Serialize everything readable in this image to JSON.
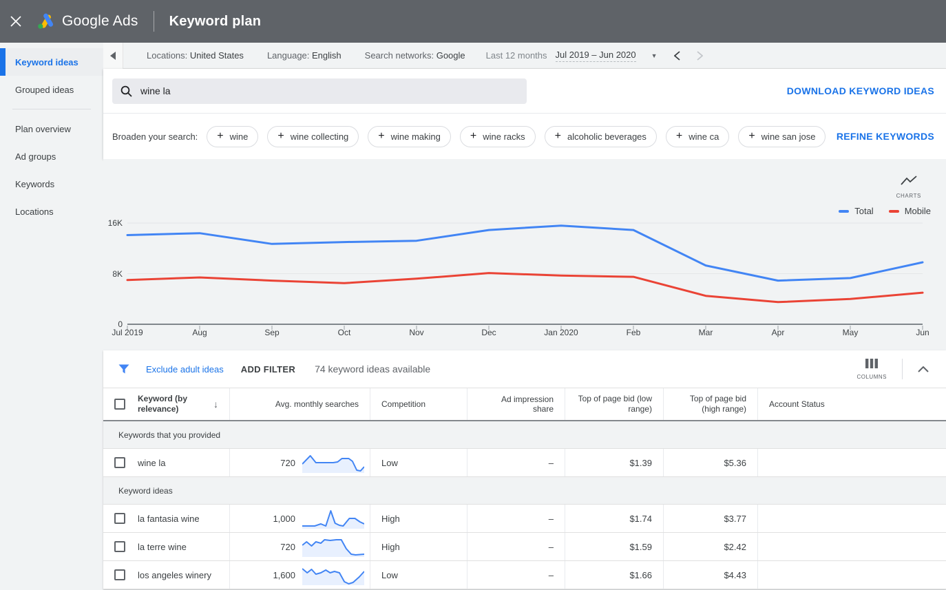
{
  "app_bar": {
    "brand": "Google Ads",
    "page_title": "Keyword plan"
  },
  "sidebar": {
    "items": [
      {
        "label": "Keyword ideas",
        "selected": true
      },
      {
        "label": "Grouped ideas",
        "selected": false
      },
      {
        "label": "Plan overview",
        "selected": false
      },
      {
        "label": "Ad groups",
        "selected": false
      },
      {
        "label": "Keywords",
        "selected": false
      },
      {
        "label": "Locations",
        "selected": false
      }
    ]
  },
  "settings_bar": {
    "locations_label": "Locations:",
    "locations_value": "United States",
    "language_label": "Language:",
    "language_value": "English",
    "networks_label": "Search networks:",
    "networks_value": "Google",
    "range_label": "Last 12 months",
    "range_value": "Jul 2019 – Jun 2020"
  },
  "search": {
    "query": "wine la",
    "download_link": "DOWNLOAD KEYWORD IDEAS"
  },
  "broaden": {
    "label": "Broaden your search:",
    "chips": [
      {
        "label": "wine"
      },
      {
        "label": "wine collecting"
      },
      {
        "label": "wine making"
      },
      {
        "label": "wine racks"
      },
      {
        "label": "alcoholic beverages"
      },
      {
        "label": "wine ca"
      },
      {
        "label": "wine san jose"
      }
    ],
    "refine_link": "REFINE KEYWORDS"
  },
  "chart_data": {
    "type": "line",
    "title": "",
    "charts_toggle_label": "CHARTS",
    "x": [
      "Jul 2019",
      "Aug",
      "Sep",
      "Oct",
      "Nov",
      "Dec",
      "Jan 2020",
      "Feb",
      "Mar",
      "Apr",
      "May",
      "Jun"
    ],
    "series": [
      {
        "name": "Total",
        "color": "#4285f4",
        "values": [
          14100,
          14400,
          12700,
          13000,
          13200,
          14900,
          15600,
          14900,
          9300,
          6900,
          7300,
          9800
        ]
      },
      {
        "name": "Mobile",
        "color": "#ea4335",
        "values": [
          7000,
          7400,
          6900,
          6500,
          7200,
          8100,
          7700,
          7500,
          4500,
          3500,
          4000,
          5000
        ]
      }
    ],
    "ylim": [
      0,
      16000
    ],
    "yticks": [
      "16K",
      "8K",
      "0"
    ],
    "grid": "horizontal",
    "legend_position": "top-right"
  },
  "filter_bar": {
    "exclude_link": "Exclude adult ideas",
    "add_filter": "ADD FILTER",
    "count_text": "74 keyword ideas available",
    "columns_label": "COLUMNS"
  },
  "table": {
    "columns": [
      "Keyword (by relevance)",
      "Avg. monthly searches",
      "Competition",
      "Ad impression share",
      "Top of page bid (low range)",
      "Top of page bid (high range)",
      "Account Status"
    ],
    "sections": [
      {
        "label": "Keywords that you provided"
      },
      {
        "label": "Keyword ideas"
      }
    ],
    "rows": [
      {
        "keyword": "wine la",
        "searches": "720",
        "competition": "Low",
        "ad_impression_share": "–",
        "top_bid_low": "$1.39",
        "top_bid_high": "$5.36",
        "account_status": "",
        "spark": [
          [
            0,
            17
          ],
          [
            13,
            5
          ],
          [
            22,
            15
          ],
          [
            50,
            15
          ],
          [
            57,
            14
          ],
          [
            64,
            9
          ],
          [
            75,
            9
          ],
          [
            81,
            13
          ],
          [
            88,
            26
          ],
          [
            94,
            27
          ],
          [
            100,
            21
          ]
        ]
      },
      {
        "keyword": "la fantasia wine",
        "searches": "1,000",
        "competition": "High",
        "ad_impression_share": "–",
        "top_bid_low": "$1.74",
        "top_bid_high": "$3.77",
        "account_status": "",
        "spark": [
          [
            0,
            26
          ],
          [
            20,
            26
          ],
          [
            30,
            23
          ],
          [
            38,
            26
          ],
          [
            46,
            4
          ],
          [
            53,
            22
          ],
          [
            60,
            25
          ],
          [
            66,
            26
          ],
          [
            76,
            15
          ],
          [
            85,
            15
          ],
          [
            93,
            20
          ],
          [
            100,
            23
          ]
        ]
      },
      {
        "keyword": "la terre wine",
        "searches": "720",
        "competition": "High",
        "ad_impression_share": "–",
        "top_bid_low": "$1.59",
        "top_bid_high": "$2.42",
        "account_status": "",
        "spark": [
          [
            0,
            13
          ],
          [
            7,
            8
          ],
          [
            15,
            14
          ],
          [
            22,
            8
          ],
          [
            30,
            10
          ],
          [
            36,
            5
          ],
          [
            45,
            6
          ],
          [
            55,
            5
          ],
          [
            63,
            5
          ],
          [
            71,
            18
          ],
          [
            79,
            26
          ],
          [
            86,
            27
          ],
          [
            100,
            26
          ]
        ]
      },
      {
        "keyword": "los angeles winery",
        "searches": "1,600",
        "competition": "Low",
        "ad_impression_share": "–",
        "top_bid_low": "$1.66",
        "top_bid_high": "$4.43",
        "account_status": "",
        "spark": [
          [
            0,
            6
          ],
          [
            8,
            12
          ],
          [
            15,
            7
          ],
          [
            22,
            14
          ],
          [
            30,
            12
          ],
          [
            38,
            8
          ],
          [
            45,
            12
          ],
          [
            52,
            10
          ],
          [
            60,
            12
          ],
          [
            68,
            25
          ],
          [
            75,
            28
          ],
          [
            82,
            26
          ],
          [
            92,
            18
          ],
          [
            100,
            10
          ]
        ]
      }
    ]
  },
  "colors": {
    "accent_blue": "#1a73e8",
    "chart_blue": "#4285f4",
    "chart_red": "#ea4335",
    "appbar_bg": "#5f6368",
    "panel_gray": "#f1f3f4",
    "spark_fill": "#e8f0fe"
  }
}
